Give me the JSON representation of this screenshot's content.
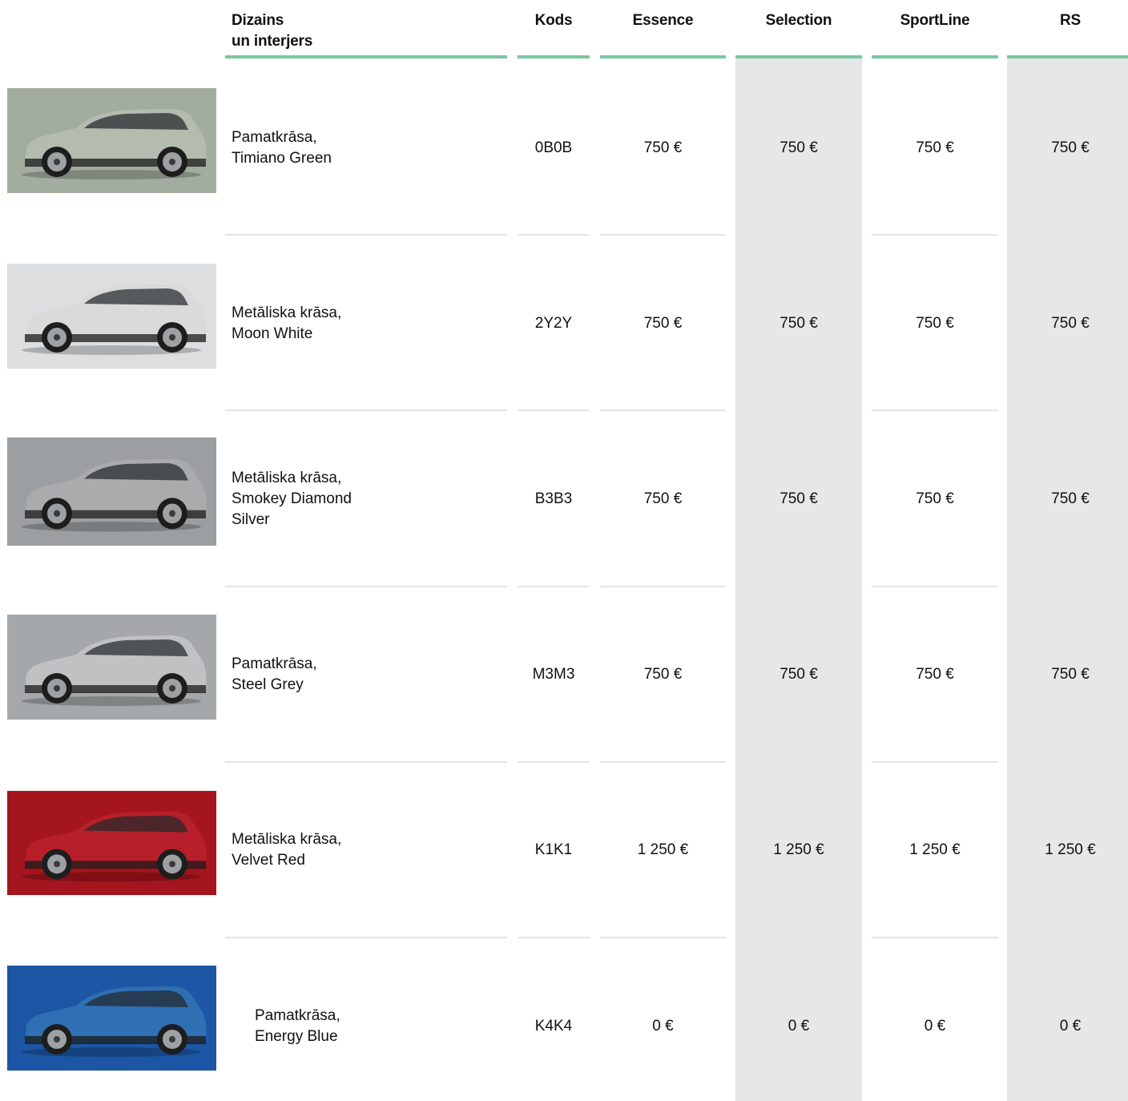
{
  "headers": {
    "design_line1": "Dizains",
    "design_line2": "un interjers",
    "code": "Kods",
    "trims": [
      "Essence",
      "Selection",
      "SportLine",
      "RS"
    ]
  },
  "colors": {
    "accent_line": "#78c8a0",
    "shaded_column": "#e6e7e9",
    "divider": "#e3e4e6"
  },
  "rows": [
    {
      "name_line1": "Pamatkrāsa,",
      "name_line2": "Timiano Green",
      "name_line3": "",
      "code": "0B0B",
      "prices": [
        "750 €",
        "750 €",
        "750 €",
        "750 €"
      ],
      "car_color": "#b4bcb0",
      "bg_color": "#a3ad9f"
    },
    {
      "name_line1": "Metāliska krāsa,",
      "name_line2": "Moon White",
      "name_line3": "",
      "code": "2Y2Y",
      "prices": [
        "750 €",
        "750 €",
        "750 €",
        "750 €"
      ],
      "car_color": "#d9dbdb",
      "bg_color": "#dcdedf"
    },
    {
      "name_line1": "Metāliska krāsa,",
      "name_line2": "Smokey Diamond",
      "name_line3": "Silver",
      "code": "B3B3",
      "prices": [
        "750 €",
        "750 €",
        "750 €",
        "750 €"
      ],
      "car_color": "#a9abad",
      "bg_color": "#9c9fa1"
    },
    {
      "name_line1": "Pamatkrāsa,",
      "name_line2": "Steel Grey",
      "name_line3": "",
      "code": "M3M3",
      "prices": [
        "750 €",
        "750 €",
        "750 €",
        "750 €"
      ],
      "car_color": "#bfc1c3",
      "bg_color": "#a5a8aa"
    },
    {
      "name_line1": "Metāliska krāsa,",
      "name_line2": "Velvet Red",
      "name_line3": "",
      "code": "K1K1",
      "prices": [
        "1 250 €",
        "1 250 €",
        "1 250 €",
        "1 250 €"
      ],
      "car_color": "#b7202a",
      "bg_color": "#a5151d"
    },
    {
      "name_line1": "Pamatkrāsa,",
      "name_line2": "Energy Blue",
      "name_line3": "",
      "code": "K4K4",
      "prices": [
        "0 €",
        "0 €",
        "0 €",
        "0 €"
      ],
      "car_color": "#2f6fb4",
      "bg_color": "#1c56a4"
    }
  ]
}
